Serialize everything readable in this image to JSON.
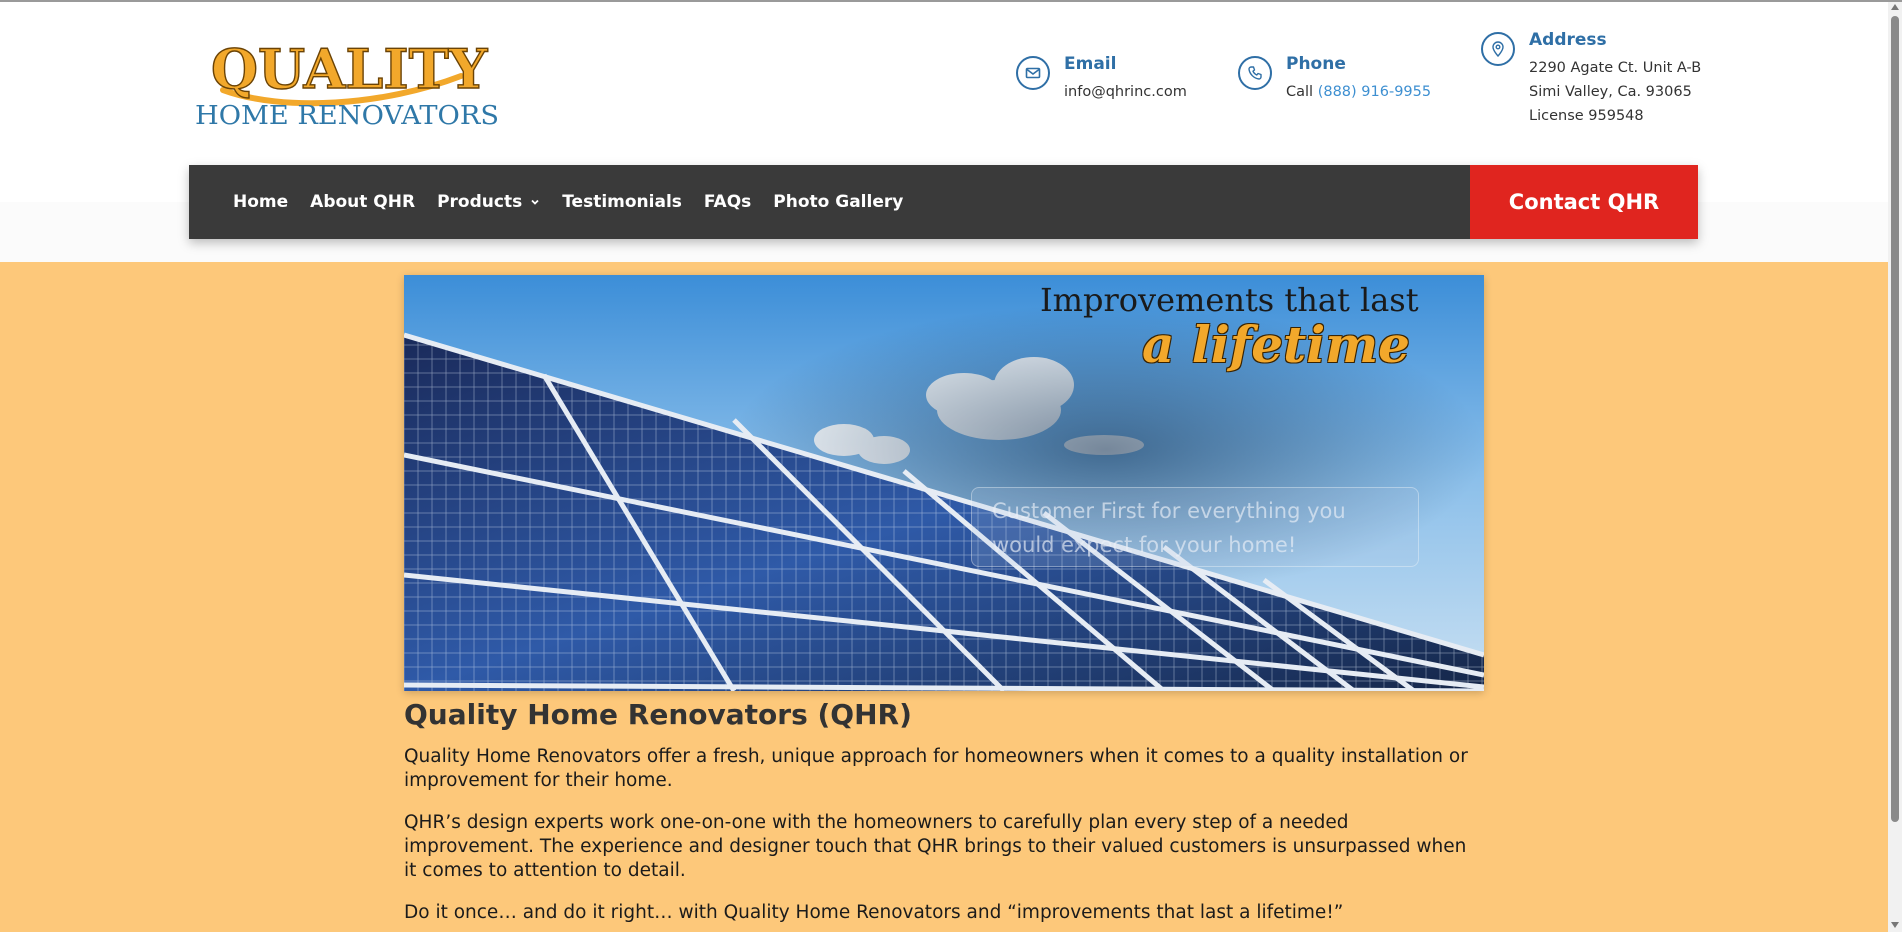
{
  "brand": {
    "logo_line1": "QUALITY",
    "logo_line2": "HOME RENOVATORS",
    "colors": {
      "gold": "#f2a82b",
      "blue": "#2f78a8"
    }
  },
  "contact": {
    "email": {
      "title": "Email",
      "value": "info@qhrinc.com",
      "icon": "envelope-icon"
    },
    "phone": {
      "title": "Phone",
      "prefix": "Call",
      "number": "(888) 916-9955",
      "icon": "phone-icon"
    },
    "address": {
      "title": "Address",
      "line1": "2290 Agate Ct. Unit A-B",
      "line2": "Simi Valley, Ca. 93065",
      "line3": "License 959548",
      "icon": "map-pin-icon"
    }
  },
  "nav": {
    "items": [
      {
        "label": "Home"
      },
      {
        "label": "About QHR"
      },
      {
        "label": "Products",
        "has_dropdown": true
      },
      {
        "label": "Testimonials"
      },
      {
        "label": "FAQs"
      },
      {
        "label": "Photo Gallery"
      }
    ],
    "cta": "Contact QHR",
    "colors": {
      "bar": "#3a3a3a",
      "cta": "#e0251f"
    }
  },
  "hero": {
    "tagline_line1": "Improvements that last",
    "tagline_line2": "a lifetime",
    "caption": "Customer First for everything you would expect for your home!"
  },
  "content": {
    "heading": "Quality Home Renovators (QHR)",
    "paragraphs": [
      "Quality Home Renovators offer a fresh, unique approach for homeowners when it comes to a quality installation or improvement for their home.",
      "QHR’s design experts work one-on-one with the homeowners to carefully plan every step of a needed improvement. The experience and designer touch that QHR brings to their valued customers is unsurpassed when it comes to attention to detail.",
      "Do it once… and do it right… with Quality Home Renovators and “improvements that last a lifetime!”"
    ]
  },
  "page": {
    "background": "#fdc87a"
  }
}
